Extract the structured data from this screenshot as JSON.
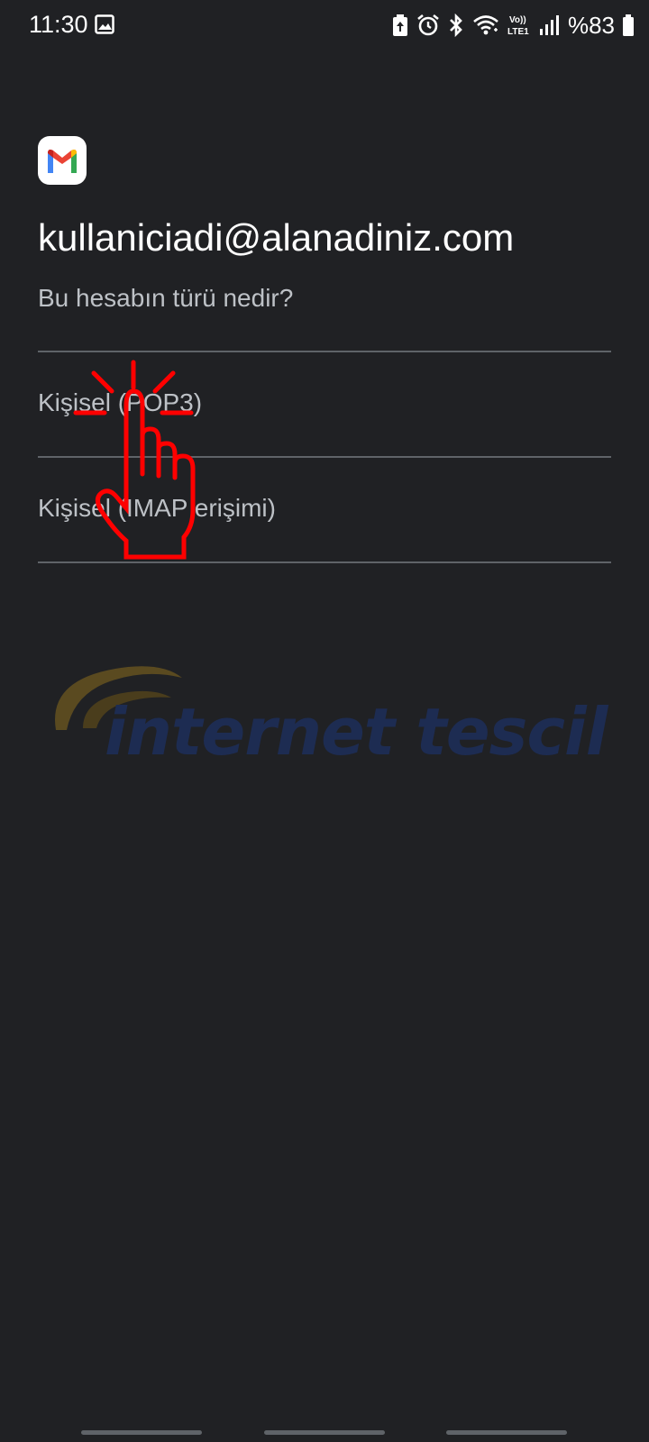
{
  "status_bar": {
    "time": "11:30",
    "battery_percent": "%83",
    "icons": [
      "gallery-icon",
      "battery-saver-icon",
      "alarm-icon",
      "bluetooth-icon",
      "wifi-icon",
      "volte-lte1-icon",
      "signal-icon",
      "battery-icon"
    ]
  },
  "app": {
    "logo_icon": "gmail-logo-icon"
  },
  "header": {
    "email": "kullaniciadi@alanadiniz.com",
    "question": "Bu hesabın türü nedir?"
  },
  "options": [
    {
      "label": "Kişisel (POP3)"
    },
    {
      "label": "Kişisel (IMAP erişimi)"
    }
  ],
  "watermark": {
    "text": "internet tescil"
  },
  "overlay": {
    "icon": "tap-hand-icon",
    "color": "#ff0000"
  },
  "colors": {
    "background": "#202124",
    "divider": "#5f6368",
    "primary_text": "#ffffff",
    "secondary_text": "#bdc1c6"
  }
}
